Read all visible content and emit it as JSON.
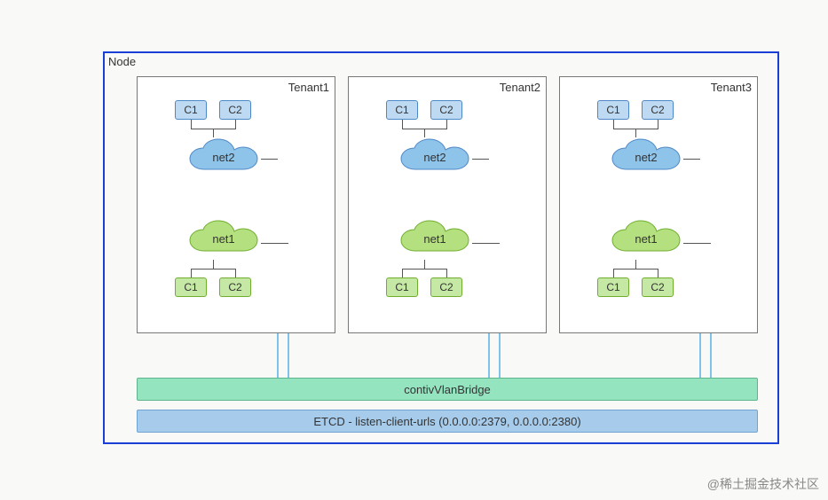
{
  "node_label": "Node",
  "tenants": [
    {
      "name": "Tenant1",
      "top_c1": "C1",
      "top_c2": "C2",
      "net_blue": "net2",
      "net_green": "net1",
      "bot_c1": "C1",
      "bot_c2": "C2"
    },
    {
      "name": "Tenant2",
      "top_c1": "C1",
      "top_c2": "C2",
      "net_blue": "net2",
      "net_green": "net1",
      "bot_c1": "C1",
      "bot_c2": "C2"
    },
    {
      "name": "Tenant3",
      "top_c1": "C1",
      "top_c2": "C2",
      "net_blue": "net2",
      "net_green": "net1",
      "bot_c1": "C1",
      "bot_c2": "C2"
    }
  ],
  "bridge_label": "contivVlanBridge",
  "etcd_label": "ETCD - listen-client-urls (0.0.0.0:2379, 0.0.0.0:2380)",
  "watermark": "@稀土掘金技术社区",
  "chart_data": {
    "type": "diagram",
    "title": "Node",
    "annotations": [
      "contivVlanBridge",
      "ETCD - listen-client-urls (0.0.0.0:2379, 0.0.0.0:2380)"
    ],
    "tenants": [
      {
        "name": "Tenant1",
        "containers_on_net2": [
          "C1",
          "C2"
        ],
        "containers_on_net1": [
          "C1",
          "C2"
        ],
        "networks": [
          "net2",
          "net1"
        ]
      },
      {
        "name": "Tenant2",
        "containers_on_net2": [
          "C1",
          "C2"
        ],
        "containers_on_net1": [
          "C1",
          "C2"
        ],
        "networks": [
          "net2",
          "net1"
        ]
      },
      {
        "name": "Tenant3",
        "containers_on_net2": [
          "C1",
          "C2"
        ],
        "containers_on_net1": [
          "C1",
          "C2"
        ],
        "networks": [
          "net2",
          "net1"
        ]
      }
    ],
    "links": [
      "Each tenant's net1 and net2 connect to contivVlanBridge",
      "contivVlanBridge sits above ETCD bar"
    ]
  }
}
